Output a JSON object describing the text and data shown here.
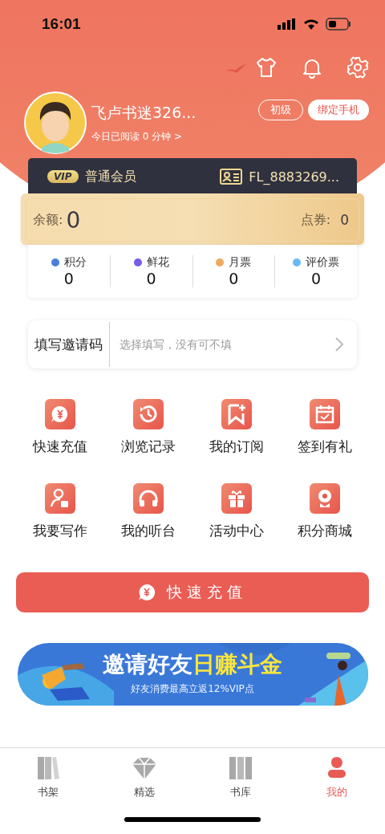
{
  "status_bar": {
    "time": "16:01"
  },
  "profile": {
    "name": "飞卢书迷326...",
    "reading_today": "今日已阅读 0 分钟 >",
    "level_badge": "初级",
    "bind_phone_button": "绑定手机"
  },
  "vip_card": {
    "badge": "VIP",
    "membership": "普通会员",
    "user_id": "FL_8883269..."
  },
  "balance_card": {
    "balance_label": "余额:",
    "balance": "0",
    "coupon_label": "点券:",
    "coupons": "0"
  },
  "stats": [
    {
      "label": "积分",
      "value": "0",
      "color": "#4a7fe0"
    },
    {
      "label": "鲜花",
      "value": "0",
      "color": "#7a5ce6"
    },
    {
      "label": "月票",
      "value": "0",
      "color": "#f0a860"
    },
    {
      "label": "评价票",
      "value": "0",
      "color": "#6ab8f5"
    }
  ],
  "invite_code": {
    "label": "填写邀请码",
    "placeholder": "选择填写，没有可不填"
  },
  "features": [
    {
      "label": "快速充值"
    },
    {
      "label": "浏览记录"
    },
    {
      "label": "我的订阅"
    },
    {
      "label": "签到有礼"
    },
    {
      "label": "我要写作"
    },
    {
      "label": "我的听台"
    },
    {
      "label": "活动中心"
    },
    {
      "label": "积分商城"
    }
  ],
  "recharge_button": "快速充值",
  "banner": {
    "title_white": "邀请好友",
    "title_yellow": "日赚斗金",
    "subtitle": "好友消费最高立返12%VIP点"
  },
  "tab_bar": [
    {
      "label": "书架",
      "selected": false
    },
    {
      "label": "精选",
      "selected": false
    },
    {
      "label": "书库",
      "selected": false
    },
    {
      "label": "我的",
      "selected": true
    }
  ]
}
